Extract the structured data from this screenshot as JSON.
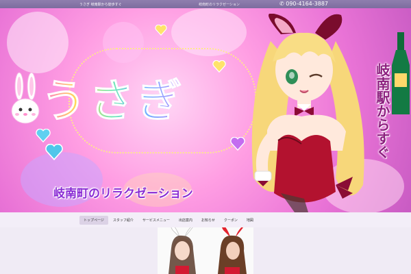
{
  "topbar": {
    "left_text": "うさぎ 岐南駅から徒歩すぐ",
    "center_text": "岐南町のリラクゼーション",
    "phone": "090-4164-3887"
  },
  "banner": {
    "logo": "うさぎ",
    "tagline": "岐南町のリラクゼーション",
    "vertical_text": "岐南駅からすぐ"
  },
  "nav": {
    "items": [
      {
        "label": "トップページ",
        "active": true
      },
      {
        "label": "スタッフ紹介",
        "active": false
      },
      {
        "label": "サービスメニュー",
        "active": false
      },
      {
        "label": "出店案内",
        "active": false
      },
      {
        "label": "お知らせ",
        "active": false
      },
      {
        "label": "クーポン",
        "active": false
      },
      {
        "label": "地図",
        "active": false
      }
    ]
  },
  "colors": {
    "topbar": "#8f7fae",
    "tagline": "#8a2bd4",
    "nav_active": "#dcd2e6"
  },
  "icons": [
    "phone-icon",
    "rabbit-mascot-icon",
    "heart-icon"
  ]
}
